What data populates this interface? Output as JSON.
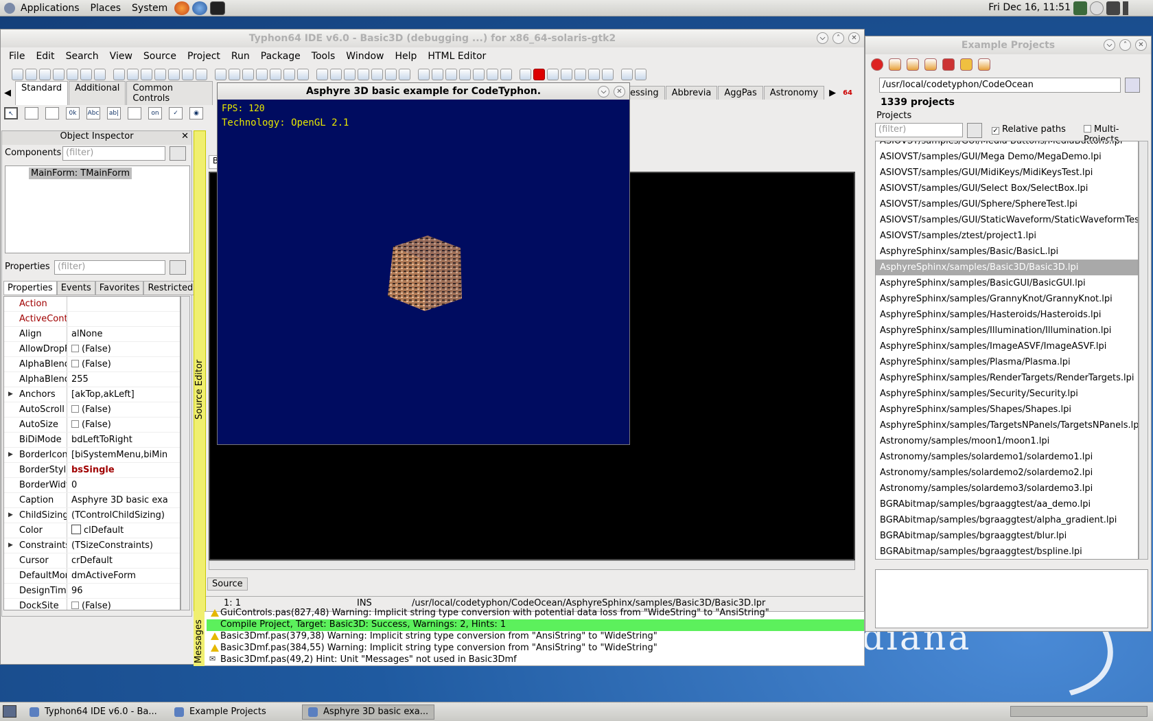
{
  "top_panel": {
    "menus": [
      "Applications",
      "Places",
      "System"
    ],
    "clock": "Fri Dec 16, 11:51"
  },
  "ide": {
    "title": "Typhon64 IDE v6.0 - Basic3D (debugging ...) for x86_64-solaris-gtk2",
    "menus": [
      "File",
      "Edit",
      "Search",
      "View",
      "Source",
      "Project",
      "Run",
      "Package",
      "Tools",
      "Window",
      "Help",
      "HTML Editor"
    ],
    "palette_tabs_left": [
      "Standard",
      "Additional",
      "Common Controls"
    ],
    "palette_tabs_right": [
      "ocessing",
      "Abbrevia",
      "AggPas",
      "Astronomy"
    ],
    "palette_badge": "64",
    "palette_icon_labels": [
      "0k",
      "Abc",
      "ab|",
      "on"
    ]
  },
  "object_inspector": {
    "title": "Object Inspector",
    "components_label": "Components",
    "filter_placeholder": "(filter)",
    "tree_item": "MainForm: TMainForm",
    "properties_label": "Properties",
    "tabs": [
      "Properties",
      "Events",
      "Favorites",
      "Restricted"
    ],
    "rows": [
      {
        "name": "Action",
        "value": "",
        "style": "red"
      },
      {
        "name": "ActiveControl",
        "value": "",
        "style": "red"
      },
      {
        "name": "Align",
        "value": "alNone"
      },
      {
        "name": "AllowDropFile",
        "value": "(False)",
        "checkbox": true
      },
      {
        "name": "AlphaBlend",
        "value": "(False)",
        "checkbox": true
      },
      {
        "name": "AlphaBlendVa",
        "value": "255"
      },
      {
        "name": "Anchors",
        "value": "[akTop,akLeft]",
        "expand": true
      },
      {
        "name": "AutoScroll",
        "value": "(False)",
        "checkbox": true
      },
      {
        "name": "AutoSize",
        "value": "(False)",
        "checkbox": true
      },
      {
        "name": "BiDiMode",
        "value": "bdLeftToRight"
      },
      {
        "name": "BorderIcons",
        "value": "[biSystemMenu,biMin",
        "expand": true
      },
      {
        "name": "BorderStyle",
        "value": "bsSingle",
        "style": "value-bold-red"
      },
      {
        "name": "BorderWidth",
        "value": "0"
      },
      {
        "name": "Caption",
        "value": "Asphyre 3D basic exa"
      },
      {
        "name": "ChildSizing",
        "value": "(TControlChildSizing)",
        "expand": true
      },
      {
        "name": "Color",
        "value": "clDefault",
        "swatch": true
      },
      {
        "name": "Constraints",
        "value": "(TSizeConstraints)",
        "expand": true
      },
      {
        "name": "Cursor",
        "value": "crDefault"
      },
      {
        "name": "DefaultMonito",
        "value": "dmActiveForm"
      },
      {
        "name": "DesignTimePI",
        "value": "96"
      },
      {
        "name": "DockSite",
        "value": "(False)",
        "checkbox": true
      }
    ]
  },
  "source_editor": {
    "strip_label": "Source Editor",
    "tab_label": "Source",
    "status_pos": "1:  1",
    "status_mode": "INS",
    "status_file": "/usr/local/codetyphon/CodeOcean/AsphyreSphinx/samples/Basic3D/Basic3D.lpr",
    "designer_tab_letter": "B"
  },
  "messages": {
    "strip_label": "Messages",
    "lines": [
      {
        "text": "GuiControls.pas(827,48) Warning: Implicit string type conversion with potential data loss from \"WideString\" to \"AnsiString\"",
        "kind": "warn"
      },
      {
        "text": "Compile Project, Target: Basic3D: Success, Warnings: 2, Hints: 1",
        "kind": "ok"
      },
      {
        "text": "Basic3Dmf.pas(379,38) Warning: Implicit string type conversion from \"AnsiString\" to \"WideString\"",
        "kind": "warn"
      },
      {
        "text": "Basic3Dmf.pas(384,55) Warning: Implicit string type conversion from \"AnsiString\" to \"WideString\"",
        "kind": "warn"
      },
      {
        "text": "Basic3Dmf.pas(49,2) Hint: Unit \"Messages\" not used in Basic3Dmf",
        "kind": "hint"
      }
    ]
  },
  "asphyre": {
    "title": "Asphyre 3D basic example for CodeTyphon.",
    "fps": "FPS: 120",
    "tech": "Technology: OpenGL 2.1"
  },
  "example_projects": {
    "title": "Example Projects",
    "path": "/usr/local/codetyphon/CodeOcean",
    "count": "1339 projects",
    "projects_label": "Projects",
    "filter_placeholder": "(filter)",
    "relative_paths": "Relative paths",
    "multi_projects": "Multi-Projects",
    "items": [
      "ASIOVST/samples/GUI/Media Buttons/MediaButtons.lpi",
      "ASIOVST/samples/GUI/Mega Demo/MegaDemo.lpi",
      "ASIOVST/samples/GUI/MidiKeys/MidiKeysTest.lpi",
      "ASIOVST/samples/GUI/Select Box/SelectBox.lpi",
      "ASIOVST/samples/GUI/Sphere/SphereTest.lpi",
      "ASIOVST/samples/GUI/StaticWaveform/StaticWaveformTes",
      "ASIOVST/samples/ztest/project1.lpi",
      "AsphyreSphinx/samples/Basic/BasicL.lpi",
      "AsphyreSphinx/samples/Basic3D/Basic3D.lpi",
      "AsphyreSphinx/samples/BasicGUI/BasicGUI.lpi",
      "AsphyreSphinx/samples/GrannyKnot/GrannyKnot.lpi",
      "AsphyreSphinx/samples/Hasteroids/Hasteroids.lpi",
      "AsphyreSphinx/samples/Illumination/Illumination.lpi",
      "AsphyreSphinx/samples/ImageASVF/ImageASVF.lpi",
      "AsphyreSphinx/samples/Plasma/Plasma.lpi",
      "AsphyreSphinx/samples/RenderTargets/RenderTargets.lpi",
      "AsphyreSphinx/samples/Security/Security.lpi",
      "AsphyreSphinx/samples/Shapes/Shapes.lpi",
      "AsphyreSphinx/samples/TargetsNPanels/TargetsNPanels.lp",
      "Astronomy/samples/moon1/moon1.lpi",
      "Astronomy/samples/solardemo1/solardemo1.lpi",
      "Astronomy/samples/solardemo2/solardemo2.lpi",
      "Astronomy/samples/solardemo3/solardemo3.lpi",
      "BGRAbitmap/samples/bgraaggtest/aa_demo.lpi",
      "BGRAbitmap/samples/bgraaggtest/alpha_gradient.lpi",
      "BGRAbitmap/samples/bgraaggtest/blur.lpi",
      "BGRAbitmap/samples/bgraaggtest/bspline.lpi"
    ],
    "selected_index": 8
  },
  "taskbar": {
    "tasks": [
      "Typhon64 IDE v6.0 - Ba...",
      "Example Projects",
      "Asphyre 3D basic exa..."
    ],
    "active_index": 2
  },
  "desktop": {
    "logo_text": "diana"
  }
}
